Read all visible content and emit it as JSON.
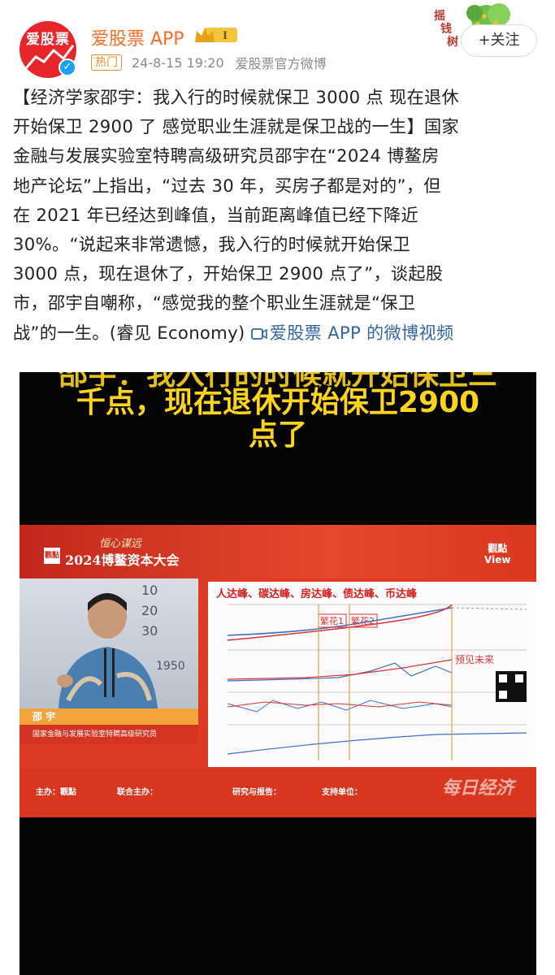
{
  "account": {
    "avatar_text": "爱股票",
    "name": "爱股票 APP",
    "level_badge": "I",
    "hot_label": "热门",
    "time": "24-8-15 19:20",
    "source": "爱股票官方微博",
    "follow_label": "+关注",
    "tree_text": "摇钱树"
  },
  "post": {
    "line1": "【经济学家邵宇：我入行的时候就保卫 3000 点 现在退休",
    "line2": "开始保卫 2900 了 感觉职业生涯就是保卫战的一生】国家",
    "line3": "金融与发展实验室特聘高级研究员邵宇在“2024 博鳌房",
    "line4": "地产论坛”上指出，“过去 30 年，买房子都是对的”，但",
    "line5": "在 2021 年已经达到峰值，当前距离峰值已经下降近",
    "line6": "30%。“说起来非常遗憾，我入行的时候就开始保卫",
    "line7": "3000 点，现在退休了，开始保卫 2900 点了”，谈起股",
    "line8": "市，邵宇自嘲称，“感觉我的整个职业生涯就是“保卫",
    "line9": "战”的一生。(睿见 Economy)",
    "video_link": "爱股票 APP 的微博视频"
  },
  "video": {
    "caption_line1": "千点，现在退休开始保卫2900",
    "caption_line2": "点了",
    "conference_subtitle": "恒心谋远",
    "conference_logo": "觀點",
    "conference_title": "2024博鳌资本大会",
    "view_logo_cn": "觀點",
    "view_logo_en": "View",
    "speaker_name": "邵 宇",
    "speaker_title": "国家金融与发展实验室特聘高级研究员",
    "slide_title": "人达峰、碳达峰、房达峰、债达峰、币达峰",
    "slide_label1": "繁花1",
    "slide_label2": "繁花2",
    "slide_label3": "预见未来",
    "sponsor1": "主办：觀點",
    "sponsor2": "联合主办：",
    "sponsor3": "研究与报告：",
    "sponsor4": "支持单位：",
    "watermark": "每日经济"
  }
}
